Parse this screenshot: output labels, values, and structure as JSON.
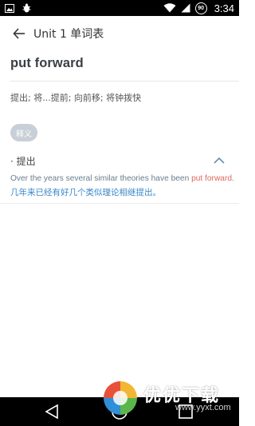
{
  "status_bar": {
    "time": "3:34",
    "battery_level": "90"
  },
  "header": {
    "title": "Unit 1 单词表"
  },
  "word": {
    "headword": "put forward",
    "short_definition": "提出; 将...提前; 向前移; 将钟拨快"
  },
  "definitions": {
    "chip_label": "释义",
    "senses": [
      {
        "label": "· 提出",
        "example_en_before": "Over the years several similar theories have been ",
        "example_en_highlight": "put forward",
        "example_en_after": ".",
        "example_zh": "几年来已经有好几个类似理论相继提出。"
      }
    ]
  },
  "colors": {
    "highlight": "#e0675c",
    "chinese_example": "#3a88c8",
    "chip_bg": "#c8cfd6"
  },
  "watermark": {
    "text": "优优下载",
    "url": "www.yyxt.com"
  }
}
